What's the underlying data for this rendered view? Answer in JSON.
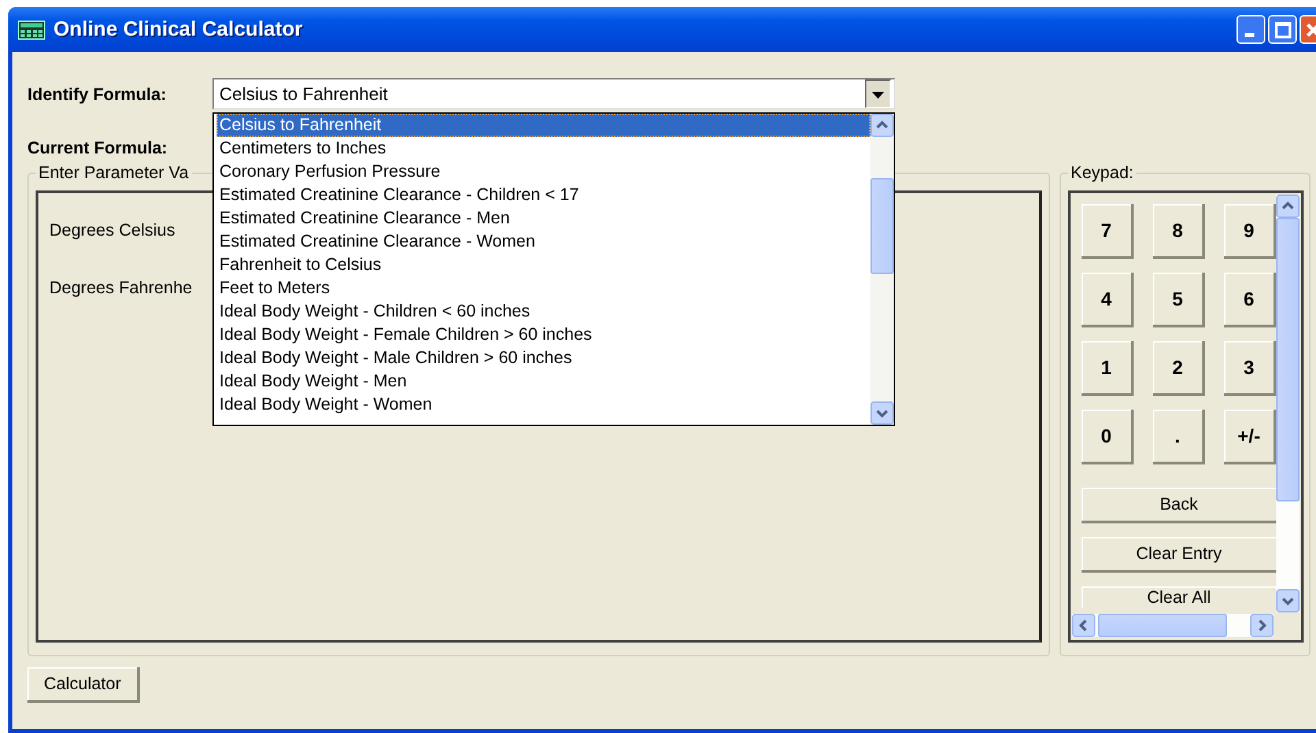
{
  "window": {
    "title": "Online Clinical Calculator"
  },
  "identify_formula": {
    "label": "Identify Formula:",
    "value": "Celsius to Fahrenheit",
    "expanded": true,
    "options": [
      {
        "label": "Celsius to Fahrenheit",
        "selected": true
      },
      {
        "label": "Centimeters to Inches",
        "selected": false
      },
      {
        "label": "Coronary Perfusion Pressure",
        "selected": false
      },
      {
        "label": "Estimated Creatinine Clearance  - Children < 17",
        "selected": false
      },
      {
        "label": "Estimated Creatinine Clearance - Men",
        "selected": false
      },
      {
        "label": "Estimated Creatinine Clearance - Women",
        "selected": false
      },
      {
        "label": "Fahrenheit to Celsius",
        "selected": false
      },
      {
        "label": "Feet to Meters",
        "selected": false
      },
      {
        "label": "Ideal Body Weight - Children < 60 inches",
        "selected": false
      },
      {
        "label": "Ideal Body Weight - Female Children > 60 inches",
        "selected": false
      },
      {
        "label": "Ideal Body Weight - Male Children > 60 inches",
        "selected": false
      },
      {
        "label": "Ideal Body Weight - Men",
        "selected": false
      },
      {
        "label": "Ideal Body Weight - Women",
        "selected": false
      }
    ]
  },
  "current_formula": {
    "label": "Current Formula:"
  },
  "parameters": {
    "legend": "Enter Parameter Va",
    "fields": [
      {
        "label": "Degrees Celsius"
      },
      {
        "label": "Degrees Fahrenhe"
      }
    ]
  },
  "keypad": {
    "legend": "Keypad:",
    "keys": [
      "7",
      "8",
      "9",
      "4",
      "5",
      "6",
      "1",
      "2",
      "3",
      "0",
      ".",
      "+/-"
    ],
    "actions": [
      "Back",
      "Clear Entry",
      "Clear All"
    ]
  },
  "buttons": [
    "Calculator"
  ]
}
